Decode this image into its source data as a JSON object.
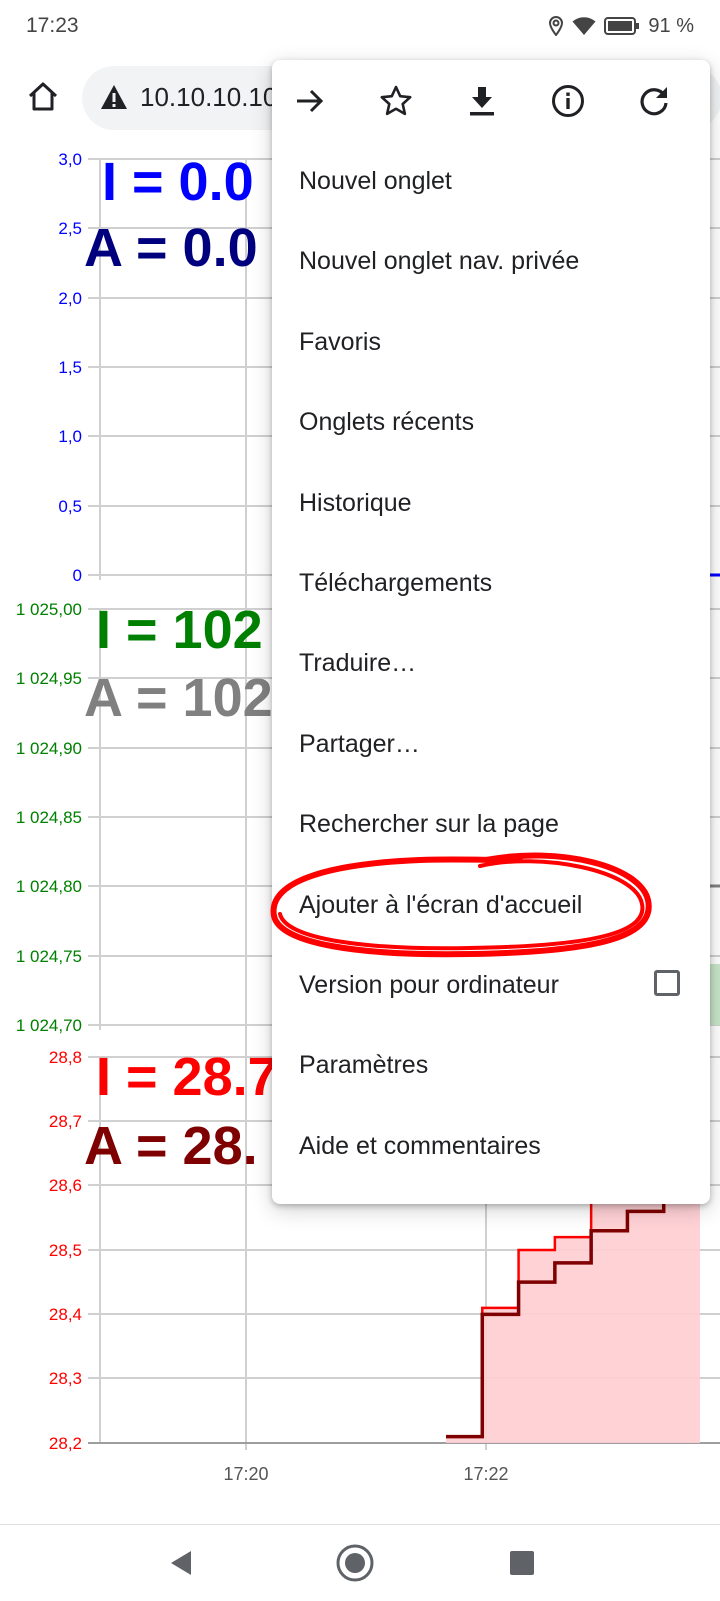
{
  "status_bar": {
    "time": "17:23",
    "battery": "91 %",
    "icons": [
      "location-icon",
      "wifi-icon",
      "battery-icon"
    ]
  },
  "toolbar": {
    "home_icon": "home-icon",
    "url": "10.10.10.10",
    "security_icon": "warning-icon"
  },
  "charts": {
    "chart1": {
      "label_i": "I = 0.0",
      "label_a": "A = 0.0",
      "yticks": [
        "3,0",
        "2,5",
        "2,0",
        "1,5",
        "1,0",
        "0,5",
        "0"
      ],
      "color_i": "#0000ff",
      "color_a": "#00007f"
    },
    "chart2": {
      "label_i": "I = 102",
      "label_a": "A = 102",
      "yticks": [
        "1 025,00",
        "1 024,95",
        "1 024,90",
        "1 024,85",
        "1 024,80",
        "1 024,75",
        "1 024,70"
      ],
      "color_i": "#008000",
      "color_a": "#808080"
    },
    "chart3": {
      "label_i": "I = 28.7",
      "label_a": "A = 28.",
      "yticks": [
        "28,8",
        "28,7",
        "28,6",
        "28,5",
        "28,4",
        "28,3",
        "28,2"
      ],
      "xticks": [
        "17:20",
        "17:22"
      ],
      "color_i": "#ff0000",
      "color_a": "#7f0000"
    }
  },
  "chart_data": {
    "type": "line",
    "x": [
      "17:21.7",
      "17:21.8",
      "17:22.0",
      "17:22.3",
      "17:22.6",
      "17:23.0",
      "17:23.3",
      "17:23.6"
    ],
    "xticks": [
      "17:20",
      "17:22"
    ],
    "ylim": [
      28.2,
      28.8
    ],
    "series": [
      {
        "name": "I",
        "values": [
          28.21,
          28.41,
          28.5,
          28.52,
          28.59,
          28.62,
          28.7,
          28.6
        ]
      },
      {
        "name": "A",
        "values": [
          28.21,
          28.4,
          28.45,
          28.48,
          28.53,
          28.56,
          28.58,
          28.59
        ]
      }
    ]
  },
  "menu": {
    "icons": [
      "forward-icon",
      "star-icon",
      "download-icon",
      "info-icon",
      "refresh-icon"
    ],
    "items": [
      "Nouvel onglet",
      "Nouvel onglet nav. privée",
      "Favoris",
      "Onglets récents",
      "Historique",
      "Téléchargements",
      "Traduire…",
      "Partager…",
      "Rechercher sur la page",
      "Ajouter à l'écran d'accueil",
      "Version pour ordinateur",
      "Paramètres",
      "Aide et commentaires"
    ],
    "desktop_checked": false,
    "highlight_color": "#ff0000"
  },
  "nav_bar": {
    "icons": [
      "back-icon",
      "home-circle-icon",
      "recents-icon"
    ]
  }
}
